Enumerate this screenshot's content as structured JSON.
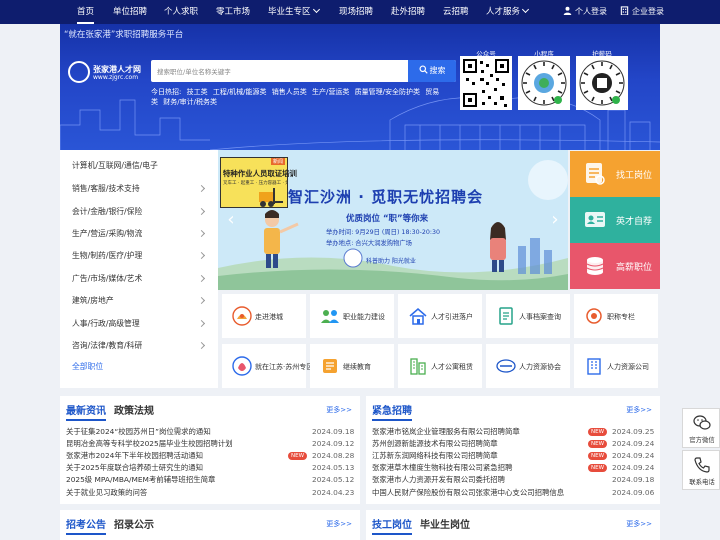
{
  "nav": {
    "items": [
      "首页",
      "单位招聘",
      "个人求职",
      "零工市场",
      "毕业生专区",
      "现场招聘",
      "赴外招聘",
      "云招聘",
      "人才服务"
    ],
    "personal_login": "个人登录",
    "company_login": "企业登录"
  },
  "hero": {
    "slogan": "“就在张家港”求职招聘服务平台",
    "logo_title": "张家港人才网",
    "logo_url": "www.zjgrc.com",
    "search_placeholder": "搜索职位/单位名称关键字",
    "search_button": "搜索",
    "hot_label": "今日热招:",
    "hot_items": [
      "技工类",
      "工程/机械/能源类",
      "销售人员类",
      "生产/营运类",
      "质量管理/安全防护类",
      "贸易类",
      "财务/审计/税务类"
    ],
    "qr_labels": [
      "公众号",
      "小程序",
      "护薪码"
    ]
  },
  "categories": [
    "计算机/互联网/通信/电子",
    "销售/客服/技术支持",
    "会计/金融/银行/保险",
    "生产/营运/采购/物流",
    "生物/制药/医疗/护理",
    "广告/市场/媒体/艺术",
    "建筑/房地产",
    "人事/行政/高级管理",
    "咨询/法律/教育/科研",
    "全部职位"
  ],
  "promo": {
    "title": "特种作业人员取证培训",
    "subtitle": "叉车工 · 起重工 · 压力容器工 · 焊工 · 保护工",
    "tag": "新闻"
  },
  "banner": {
    "title": "智汇沙洲 · 觅职无忧招聘会",
    "subtitle": "优质岗位 “职”等你来",
    "time": "举办时间: 9月29日 (周日) 18:30-20:30",
    "place": "举办地点: 合兴大润发购物广场",
    "footer": "科普助力   阳光就业"
  },
  "quick": [
    "找工岗位",
    "英才自荐",
    "高薪职位"
  ],
  "services": [
    [
      "走进港城",
      "职业能力建设",
      "人才引进落户",
      "人事档案查询",
      "职称专栏"
    ],
    [
      "就在江苏·苏州专区",
      "继续教育",
      "人才公寓租赁",
      "人力资源协会",
      "人力资源公司"
    ]
  ],
  "news": {
    "tab_active": "最新资讯",
    "tab_other": "政策法规",
    "more": "更多>>",
    "new_label": "NEW",
    "rows": [
      {
        "title": "关于征集2024“校园苏州日”岗位需求的通知",
        "date": "2024.09.18",
        "new": false
      },
      {
        "title": "昆明冶金高等专科学校2025届毕业生校园招聘计划",
        "date": "2024.09.12",
        "new": false
      },
      {
        "title": "张家港市2024年下半年校园招聘活动通知",
        "date": "2024.08.28",
        "new": true
      },
      {
        "title": "关于2025年度联合培养硕士研究生的通知",
        "date": "2024.05.13",
        "new": false
      },
      {
        "title": "2025级 MPA/MBA/MEM考前辅导班招生简章",
        "date": "2024.05.12",
        "new": false
      },
      {
        "title": "关于就业见习政策的问答",
        "date": "2024.04.23",
        "new": false
      }
    ]
  },
  "urgent": {
    "tab_active": "紧急招聘",
    "more": "更多>>",
    "new_label": "NEW",
    "rows": [
      {
        "title": "张家港市铭岚企业管理服务有限公司招聘简章",
        "date": "2024.09.25",
        "new": true
      },
      {
        "title": "苏州创源新能源技术有限公司招聘简章",
        "date": "2024.09.24",
        "new": true
      },
      {
        "title": "江苏新东润网络科技有限公司招聘简章",
        "date": "2024.09.24",
        "new": true
      },
      {
        "title": "张家港草木橦度生物科技有限公司紧急招聘",
        "date": "2024.09.24",
        "new": true
      },
      {
        "title": "张家港市人力资源开发有限公司委托招聘",
        "date": "2024.09.18",
        "new": false
      },
      {
        "title": "中国人民财产保险股份有限公司张家港中心支公司招聘信息",
        "date": "2024.09.06",
        "new": false
      }
    ]
  },
  "exam": {
    "tab_active": "招考公告",
    "tab_other": "招录公示",
    "more": "更多>>"
  },
  "jobs": {
    "tab_active": "技工岗位",
    "tab_other": "毕业生岗位",
    "more": "更多>>"
  },
  "sidebar": {
    "wechat": "官方微信",
    "phone": "联系电话"
  },
  "colors": {
    "nav_bg": "#0e1d6e",
    "accent": "#2d6bea",
    "new_tag": "#e74c3c"
  }
}
